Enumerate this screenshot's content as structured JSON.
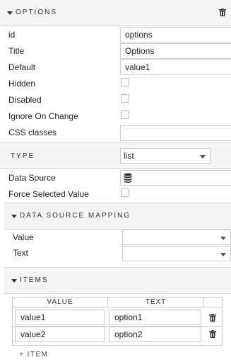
{
  "options_section": {
    "title": "OPTIONS",
    "icon": "trash-icon"
  },
  "properties": {
    "id": {
      "label": "id",
      "value": "options"
    },
    "title": {
      "label": "Title",
      "value": "Options"
    },
    "default": {
      "label": "Default",
      "value": "value1"
    },
    "hidden": {
      "label": "Hidden",
      "checked": false
    },
    "disabled": {
      "label": "Disabled",
      "checked": false
    },
    "ignore_on_change": {
      "label": "Ignore On Change",
      "checked": false
    },
    "css_classes": {
      "label": "CSS classes",
      "value": ""
    }
  },
  "type_section": {
    "label": "TYPE",
    "selected": "list"
  },
  "data_source": {
    "label": "Data Source",
    "icon": "database-icon"
  },
  "force_selected": {
    "label": "Force Selected Value",
    "checked": false
  },
  "mapping_section": {
    "title": "DATA SOURCE MAPPING",
    "value_label": "Value",
    "text_label": "Text",
    "value_selected": "",
    "text_selected": ""
  },
  "items_section": {
    "title": "ITEMS",
    "columns": [
      "VALUE",
      "TEXT"
    ],
    "rows": [
      {
        "value": "value1",
        "text": "option1"
      },
      {
        "value": "value2",
        "text": "option2"
      }
    ],
    "add_label": "+ ITEM"
  }
}
